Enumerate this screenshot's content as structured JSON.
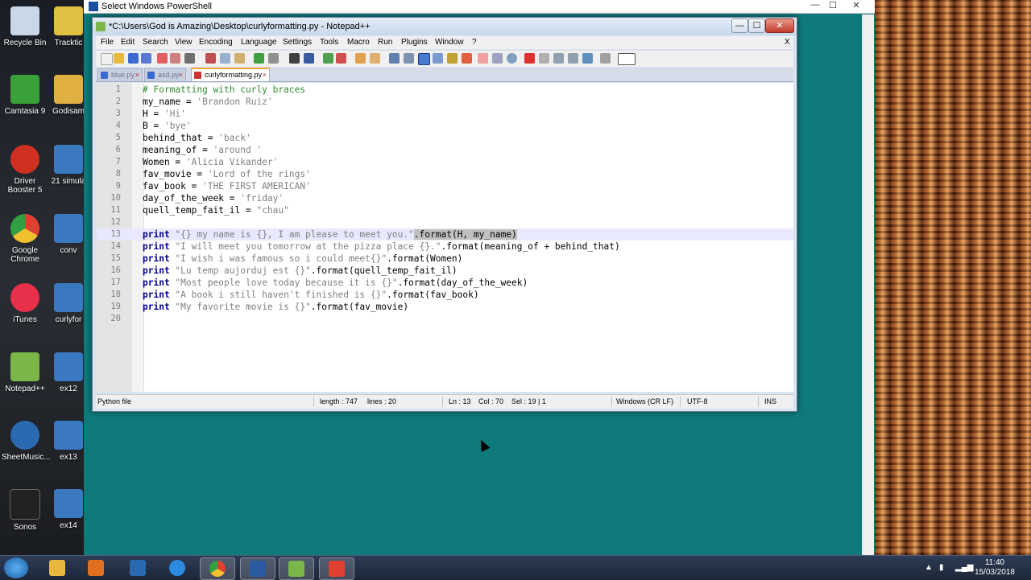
{
  "desktop": {
    "icons": [
      {
        "label": "Recycle Bin",
        "color": "#c8d8e8"
      },
      {
        "label": "Tracktic",
        "color": "#e0c040"
      },
      {
        "label": "Camtasia 9",
        "color": "#3aa03a"
      },
      {
        "label": "Godisam",
        "color": "#e0b040"
      },
      {
        "label": "Driver Booster 5",
        "color": "#d03020"
      },
      {
        "label": "21 simula",
        "color": "#3a78c0"
      },
      {
        "label": "Google Chrome",
        "color": "#e04030"
      },
      {
        "label": "conv",
        "color": "#3a78c0"
      },
      {
        "label": "iTunes",
        "color": "#e8304a"
      },
      {
        "label": "curlyfor",
        "color": "#3a78c0"
      },
      {
        "label": "Notepad++",
        "color": "#7ab648"
      },
      {
        "label": "ex12",
        "color": "#3a78c0"
      },
      {
        "label": "SheetMusic...",
        "color": "#2a6ab0"
      },
      {
        "label": "ex13",
        "color": "#3a78c0"
      },
      {
        "label": "Sonos",
        "color": "#222222"
      },
      {
        "label": "ex14",
        "color": "#3a78c0"
      }
    ]
  },
  "powershell": {
    "title": "Select Windows PowerShell",
    "controls": [
      "—",
      "☐",
      "✕"
    ]
  },
  "notepadpp": {
    "title": "*C:\\Users\\God is Amazing\\Desktop\\curlyformatting.py - Notepad++",
    "menu": [
      "File",
      "Edit",
      "Search",
      "View",
      "Encoding",
      "Language",
      "Settings",
      "Tools",
      "Macro",
      "Run",
      "Plugins",
      "Window",
      "?"
    ],
    "menu_close": "X",
    "window_controls": [
      "—",
      "☐",
      "✕"
    ],
    "tabs": [
      {
        "label": "blue.py",
        "active": false,
        "icon_color": "#3a6ad0"
      },
      {
        "label": "asd.py",
        "active": false,
        "icon_color": "#3a6ad0"
      },
      {
        "label": "curlyformatting.py",
        "active": true,
        "icon_color": "#d03030"
      }
    ],
    "lines": [
      {
        "num": "1"
      },
      {
        "num": "2"
      },
      {
        "num": "3"
      },
      {
        "num": "4"
      },
      {
        "num": "5"
      },
      {
        "num": "6"
      },
      {
        "num": "7"
      },
      {
        "num": "8"
      },
      {
        "num": "9"
      },
      {
        "num": "10"
      },
      {
        "num": "11"
      },
      {
        "num": "12"
      },
      {
        "num": "13"
      },
      {
        "num": "14"
      },
      {
        "num": "15"
      },
      {
        "num": "16"
      },
      {
        "num": "17"
      },
      {
        "num": "18"
      },
      {
        "num": "19"
      },
      {
        "num": "20"
      }
    ],
    "code": {
      "l1": "# Formatting with curly braces",
      "l2a": "my_name = ",
      "l2b": "'Brandon Ruiz'",
      "l3a": "H = ",
      "l3b": "'Hi'",
      "l4a": "B = ",
      "l4b": "'bye'",
      "l5a": "behind_that = ",
      "l5b": "'back'",
      "l6a": "meaning_of = ",
      "l6b": "'around '",
      "l7a": "Women = ",
      "l7b": "'Alicia Vikander'",
      "l8a": "fav_movie = ",
      "l8b": "'Lord of the rings'",
      "l9a": "fav_book = ",
      "l9b": "'THE FIRST AMERICAN'",
      "l10a": "day_of_the_week = ",
      "l10b": "'friday'",
      "l11a": "quell_temp_fait_il = ",
      "l11b": "\"chau\"",
      "print": "print",
      "l13s": " \"{} my name is {}, I am please to meet you.\"",
      "l13r": ".format(H, my_name)",
      "l14s": " \"I will meet you tomorrow at the pizza place {}.\"",
      "l14r": ".format(meaning_of + behind_that)",
      "l15s": " \"I wish i was famous so i could meet{}\"",
      "l15r": ".format(Women)",
      "l16s": " \"Lu temp aujorduj est {}\"",
      "l16r": ".format(quell_temp_fait_il)",
      "l17s": " \"Most people love today because it is {}\"",
      "l17r": ".format(day_of_the_week)",
      "l18s": " \"A book i still haven't finished is {}\"",
      "l18r": ".format(fav_book)",
      "l19s": " \"My favorite movie is {}\"",
      "l19r": ".format(fav_movie)"
    },
    "status": {
      "type": "Python file",
      "length": "length : 747",
      "lines": "lines : 20",
      "ln": "Ln : 13",
      "col": "Col : 70",
      "sel": "Sel : 19 | 1",
      "eol": "Windows (CR LF)",
      "encoding": "UTF-8",
      "mode": "INS"
    }
  },
  "taskbar": {
    "apps": [
      {
        "name": "file-explorer",
        "color": "#e8b840"
      },
      {
        "name": "media-player",
        "color": "#e07020"
      },
      {
        "name": "app-a",
        "color": "#2a6ab0"
      },
      {
        "name": "internet-explorer",
        "color": "#2a8ae0"
      },
      {
        "name": "chrome",
        "color": "#e04030"
      },
      {
        "name": "powershell",
        "color": "#2a5aa0"
      },
      {
        "name": "notepad-plus-plus",
        "color": "#7ab648"
      },
      {
        "name": "camtasia",
        "color": "#e04030"
      }
    ],
    "time": "11:40",
    "date": "15/03/2018"
  }
}
